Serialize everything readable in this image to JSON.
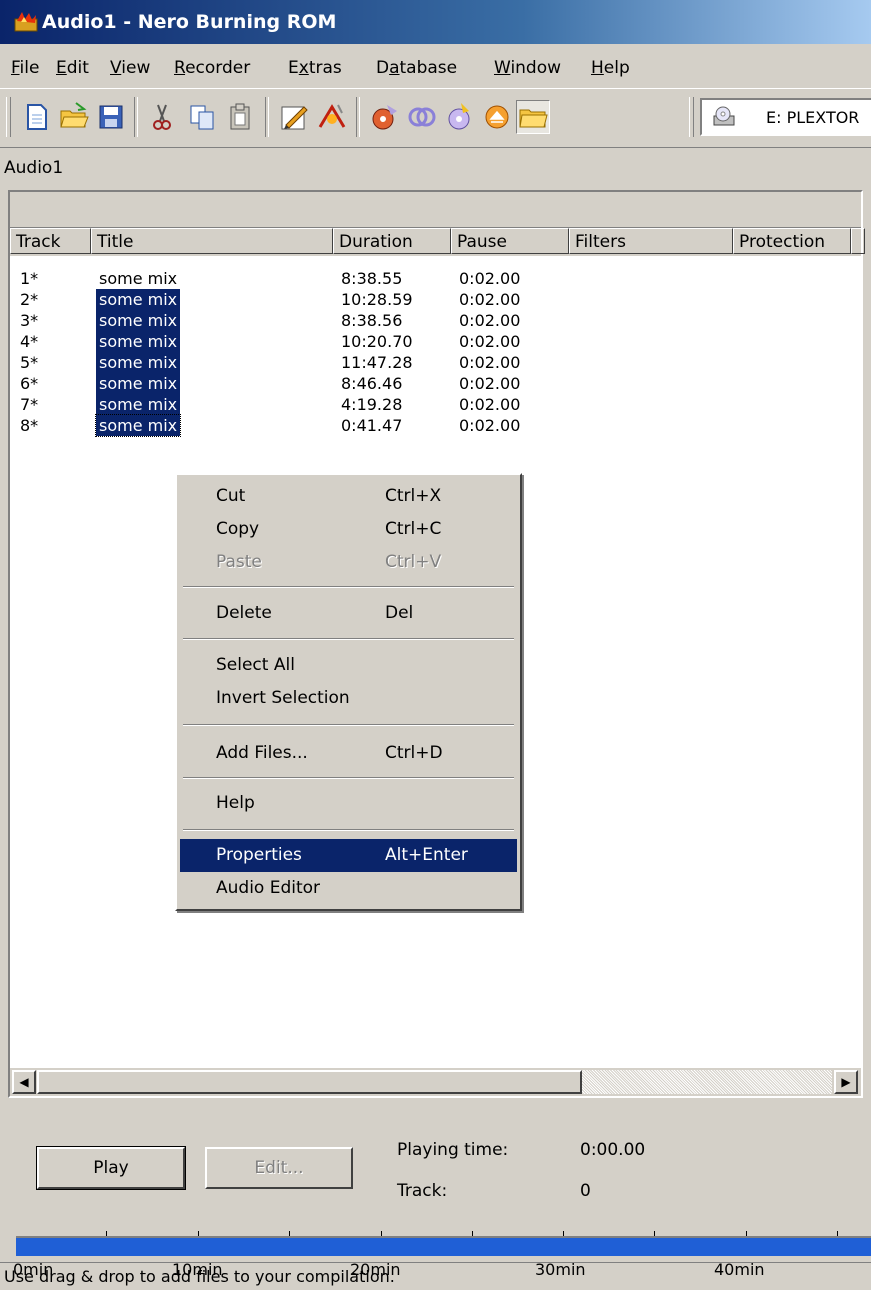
{
  "window": {
    "title": "Audio1 - Nero Burning ROM"
  },
  "menubar": [
    {
      "label": "File",
      "key": "F"
    },
    {
      "label": "Edit",
      "key": "E"
    },
    {
      "label": "View",
      "key": "V"
    },
    {
      "label": "Recorder",
      "key": "R"
    },
    {
      "label": "Extras",
      "key": "x"
    },
    {
      "label": "Database",
      "key": "a"
    },
    {
      "label": "Window",
      "key": "W"
    },
    {
      "label": "Help",
      "key": "H"
    }
  ],
  "toolbar": {
    "icons": [
      "new-icon",
      "open-icon",
      "save-icon",
      "cut-icon",
      "copy-icon",
      "paste-icon",
      "write-cd-icon",
      "burn-icon",
      "cd-copy-icon",
      "disc-info-icon",
      "disc-edit-icon",
      "eject-icon",
      "folder-icon"
    ],
    "drive": "E: PLEXTOR"
  },
  "compilation": {
    "name": "Audio1"
  },
  "tracklist": {
    "columns": [
      "Track",
      "Title",
      "Duration",
      "Pause",
      "Filters",
      "Protection"
    ],
    "rows": [
      {
        "track": "1*",
        "title": "some mix",
        "duration": "8:38.55",
        "pause": "0:02.00",
        "selected": false
      },
      {
        "track": "2*",
        "title": "some mix",
        "duration": "10:28.59",
        "pause": "0:02.00",
        "selected": true
      },
      {
        "track": "3*",
        "title": "some mix",
        "duration": "8:38.56",
        "pause": "0:02.00",
        "selected": true
      },
      {
        "track": "4*",
        "title": "some mix",
        "duration": "10:20.70",
        "pause": "0:02.00",
        "selected": true
      },
      {
        "track": "5*",
        "title": "some mix",
        "duration": "11:47.28",
        "pause": "0:02.00",
        "selected": true
      },
      {
        "track": "6*",
        "title": "some mix",
        "duration": "8:46.46",
        "pause": "0:02.00",
        "selected": true
      },
      {
        "track": "7*",
        "title": "some mix",
        "duration": "4:19.28",
        "pause": "0:02.00",
        "selected": true
      },
      {
        "track": "8*",
        "title": "some mix",
        "duration": "0:41.47",
        "pause": "0:02.00",
        "selected": true
      }
    ]
  },
  "context_menu": {
    "items": [
      {
        "label": "Cut",
        "shortcut": "Ctrl+X",
        "disabled": false
      },
      {
        "label": "Copy",
        "shortcut": "Ctrl+C",
        "disabled": false
      },
      {
        "label": "Paste",
        "shortcut": "Ctrl+V",
        "disabled": true
      },
      {
        "label": "Delete",
        "shortcut": "Del",
        "disabled": false
      },
      {
        "label": "Select All",
        "shortcut": "",
        "disabled": false
      },
      {
        "label": "Invert Selection",
        "shortcut": "",
        "disabled": false
      },
      {
        "label": "Add Files...",
        "shortcut": "Ctrl+D",
        "disabled": false
      },
      {
        "label": "Help",
        "shortcut": "",
        "disabled": false
      },
      {
        "label": "Properties",
        "shortcut": "Alt+Enter",
        "disabled": false,
        "highlighted": true
      },
      {
        "label": "Audio Editor",
        "shortcut": "",
        "disabled": false
      }
    ]
  },
  "player": {
    "play_label": "Play",
    "edit_label": "Edit...",
    "playing_time_label": "Playing time:",
    "playing_time_value": "0:00.00",
    "track_label": "Track:",
    "track_value": "0"
  },
  "timeline": {
    "labels": [
      "0min",
      "10min",
      "20min",
      "30min",
      "40min"
    ]
  },
  "statusbar": {
    "text": "Use drag & drop to add files to your compilation."
  },
  "colors": {
    "selection": "#0a246a",
    "timeline_fill": "#1f5fd6",
    "face": "#d4d0c8"
  }
}
